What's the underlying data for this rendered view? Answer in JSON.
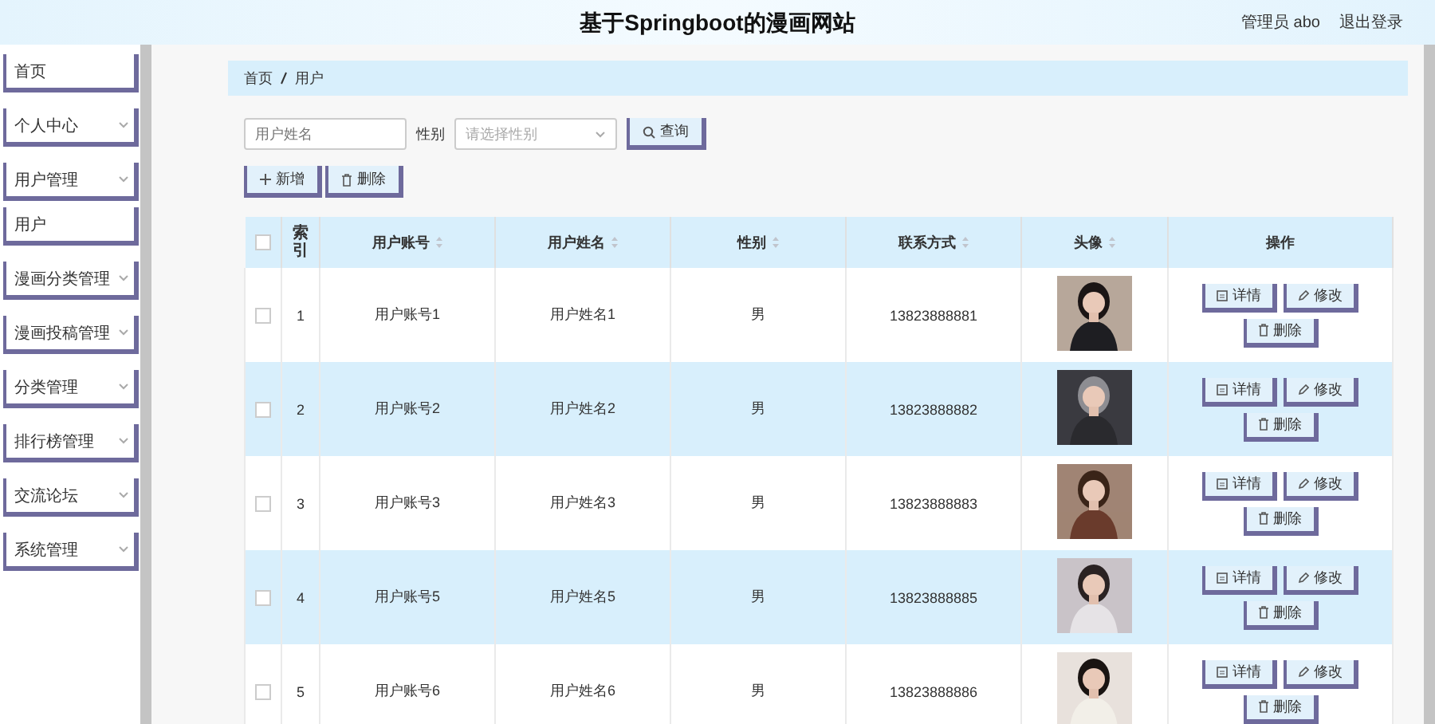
{
  "header": {
    "title": "基于Springboot的漫画网站",
    "user": "管理员 abo",
    "logout": "退出登录"
  },
  "sidebar": {
    "items": [
      {
        "label": "首页",
        "kind": "link"
      },
      {
        "label": "个人中心",
        "kind": "menu"
      },
      {
        "label": "用户管理",
        "kind": "menu",
        "children": [
          {
            "label": "用户",
            "kind": "link"
          }
        ]
      },
      {
        "label": "漫画分类管理",
        "kind": "menu"
      },
      {
        "label": "漫画投稿管理",
        "kind": "menu"
      },
      {
        "label": "分类管理",
        "kind": "menu"
      },
      {
        "label": "排行榜管理",
        "kind": "menu"
      },
      {
        "label": "交流论坛",
        "kind": "menu"
      },
      {
        "label": "系统管理",
        "kind": "menu"
      }
    ]
  },
  "breadcrumb": [
    "首页",
    "用户"
  ],
  "search": {
    "name_placeholder": "用户姓名",
    "gender_label": "性别",
    "gender_placeholder": "请选择性别",
    "query_button": "查询"
  },
  "toolbar": {
    "add_button": "新增",
    "delete_button": "删除"
  },
  "table": {
    "header_checked": false,
    "columns": [
      {
        "label": "索引",
        "sortable": false
      },
      {
        "label": "用户账号",
        "sortable": true
      },
      {
        "label": "用户姓名",
        "sortable": true
      },
      {
        "label": "性别",
        "sortable": true
      },
      {
        "label": "联系方式",
        "sortable": true
      },
      {
        "label": "头像",
        "sortable": true
      },
      {
        "label": "操作",
        "sortable": false
      }
    ],
    "rows": [
      {
        "checked": false,
        "index": "1",
        "account": "用户账号1",
        "name": "用户姓名1",
        "gender": "男",
        "phone": "13823888881",
        "actions": [
          "详情",
          "修改",
          "删除"
        ]
      },
      {
        "checked": false,
        "index": "2",
        "account": "用户账号2",
        "name": "用户姓名2",
        "gender": "男",
        "phone": "13823888882",
        "actions": [
          "详情",
          "修改",
          "删除"
        ]
      },
      {
        "checked": false,
        "index": "3",
        "account": "用户账号3",
        "name": "用户姓名3",
        "gender": "男",
        "phone": "13823888883",
        "actions": [
          "详情",
          "修改",
          "删除"
        ]
      },
      {
        "checked": false,
        "index": "4",
        "account": "用户账号5",
        "name": "用户姓名5",
        "gender": "男",
        "phone": "13823888885",
        "actions": [
          "详情",
          "修改",
          "删除"
        ]
      },
      {
        "checked": false,
        "index": "5",
        "account": "用户账号6",
        "name": "用户姓名6",
        "gender": "男",
        "phone": "13823888886",
        "actions": [
          "详情",
          "修改",
          "删除"
        ]
      }
    ]
  }
}
